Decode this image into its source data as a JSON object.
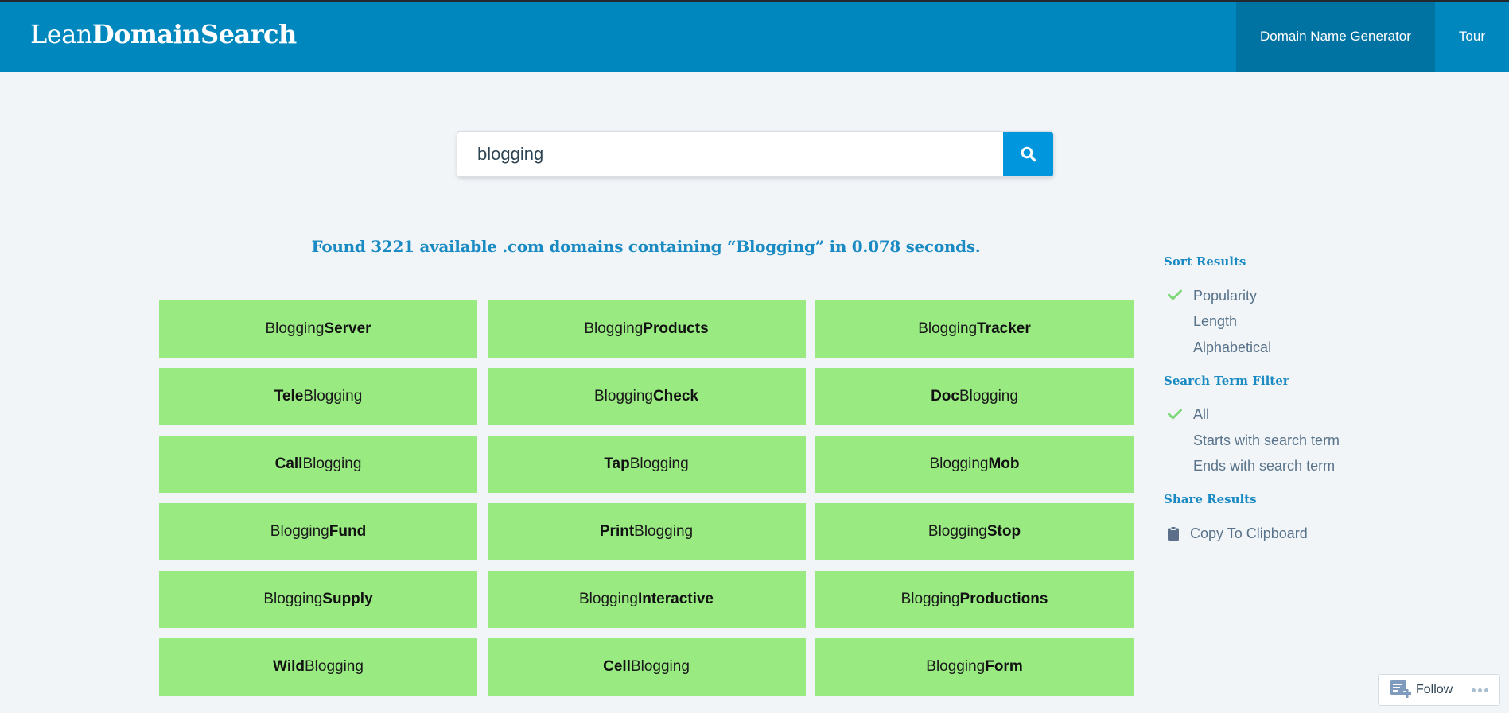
{
  "header": {
    "logo_light": "Lean",
    "logo_bold": "DomainSearch",
    "nav": [
      {
        "label": "Domain Name Generator",
        "active": true
      },
      {
        "label": "Tour",
        "active": false
      }
    ]
  },
  "search": {
    "value": "blogging",
    "button_icon": "search-icon"
  },
  "results": {
    "summary": "Found 3221 available .com domains containing “Blogging” in 0.078 seconds.",
    "domains": [
      {
        "first": "Blogging",
        "second": "Server",
        "bold": "second"
      },
      {
        "first": "Blogging",
        "second": "Products",
        "bold": "second"
      },
      {
        "first": "Blogging",
        "second": "Tracker",
        "bold": "second"
      },
      {
        "first": "Tele",
        "second": "Blogging",
        "bold": "first"
      },
      {
        "first": "Blogging",
        "second": "Check",
        "bold": "second"
      },
      {
        "first": "Doc",
        "second": "Blogging",
        "bold": "first"
      },
      {
        "first": "Call",
        "second": "Blogging",
        "bold": "first"
      },
      {
        "first": "Tap",
        "second": "Blogging",
        "bold": "first"
      },
      {
        "first": "Blogging",
        "second": "Mob",
        "bold": "second"
      },
      {
        "first": "Blogging",
        "second": "Fund",
        "bold": "second"
      },
      {
        "first": "Print",
        "second": "Blogging",
        "bold": "first"
      },
      {
        "first": "Blogging",
        "second": "Stop",
        "bold": "second"
      },
      {
        "first": "Blogging",
        "second": "Supply",
        "bold": "second"
      },
      {
        "first": "Blogging",
        "second": "Interactive",
        "bold": "second"
      },
      {
        "first": "Blogging",
        "second": "Productions",
        "bold": "second"
      },
      {
        "first": "Wild",
        "second": "Blogging",
        "bold": "first"
      },
      {
        "first": "Cell",
        "second": "Blogging",
        "bold": "first"
      },
      {
        "first": "Blogging",
        "second": "Form",
        "bold": "second"
      }
    ]
  },
  "sidebar": {
    "sort": {
      "heading": "Sort Results",
      "options": [
        {
          "label": "Popularity",
          "selected": true
        },
        {
          "label": "Length",
          "selected": false
        },
        {
          "label": "Alphabetical",
          "selected": false
        }
      ]
    },
    "filter": {
      "heading": "Search Term Filter",
      "options": [
        {
          "label": "All",
          "selected": true
        },
        {
          "label": "Starts with search term",
          "selected": false
        },
        {
          "label": "Ends with search term",
          "selected": false
        }
      ]
    },
    "share": {
      "heading": "Share Results",
      "copy_label": "Copy To Clipboard"
    }
  },
  "follow": {
    "label": "Follow"
  },
  "colors": {
    "header": "#0087be",
    "nav_active": "#0073a3",
    "accent": "#1a8ac2",
    "tile": "#98ea81",
    "check": "#7ed87a"
  }
}
